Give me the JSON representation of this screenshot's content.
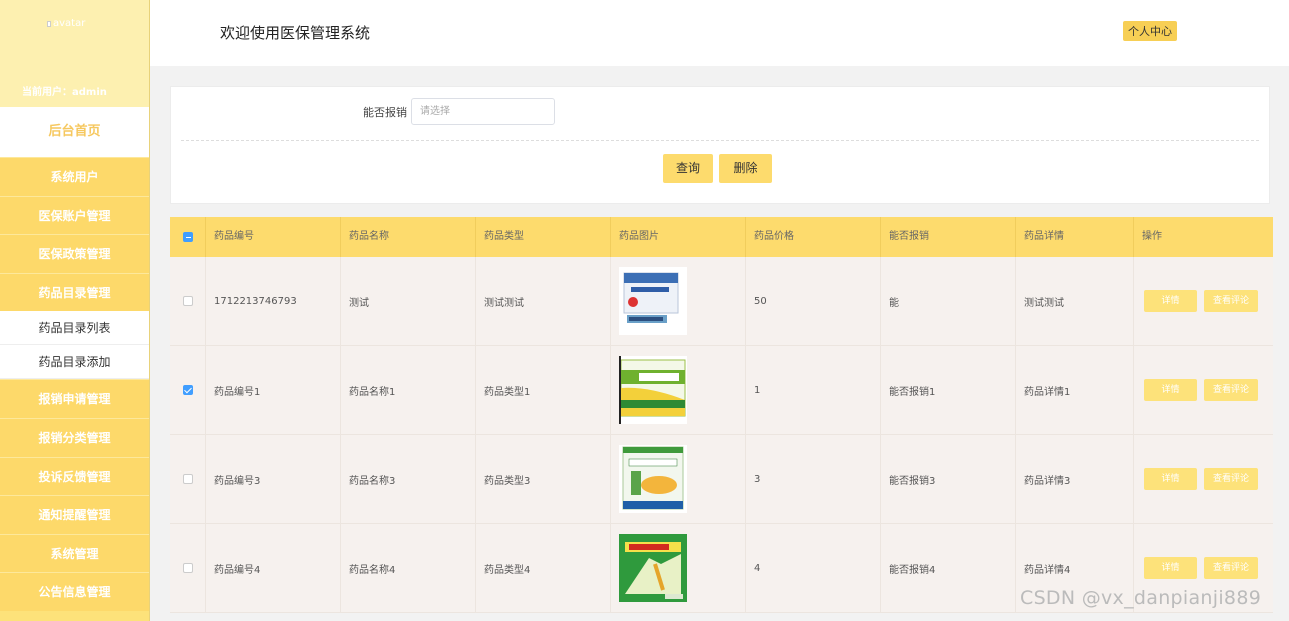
{
  "sidebar": {
    "avatar_alt": "avatar",
    "current_user": "当前用户：admin",
    "home": "后台首页",
    "menu_top": [
      "系统用户",
      "医保账户管理",
      "医保政策管理",
      "药品目录管理"
    ],
    "sub_items": [
      "药品目录列表",
      "药品目录添加"
    ],
    "menu_bottom": [
      "报销申请管理",
      "报销分类管理",
      "投诉反馈管理",
      "通知提醒管理",
      "系统管理",
      "公告信息管理"
    ]
  },
  "header": {
    "title": "欢迎使用医保管理系统",
    "profile": "个人中心"
  },
  "search": {
    "label": "能否报销",
    "placeholder": "请选择",
    "query_btn": "查询",
    "delete_btn": "删除"
  },
  "table": {
    "headers": [
      "药品编号",
      "药品名称",
      "药品类型",
      "药品图片",
      "药品价格",
      "能否报销",
      "药品详情",
      "操作"
    ],
    "detail_btn": "详情",
    "review_btn": "查看评论",
    "rows": [
      {
        "id": "1712213746793",
        "name": "测试",
        "type": "测试测试",
        "price": "50",
        "reimburse": "能",
        "detail": "测试测试",
        "checked": false
      },
      {
        "id": "药品编号1",
        "name": "药品名称1",
        "type": "药品类型1",
        "price": "1",
        "reimburse": "能否报销1",
        "detail": "药品详情1",
        "checked": true
      },
      {
        "id": "药品编号3",
        "name": "药品名称3",
        "type": "药品类型3",
        "price": "3",
        "reimburse": "能否报销3",
        "detail": "药品详情3",
        "checked": false
      },
      {
        "id": "药品编号4",
        "name": "药品名称4",
        "type": "药品类型4",
        "price": "4",
        "reimburse": "能否报销4",
        "detail": "药品详情4",
        "checked": false
      }
    ]
  },
  "watermark": "CSDN @vx_danpianji889"
}
